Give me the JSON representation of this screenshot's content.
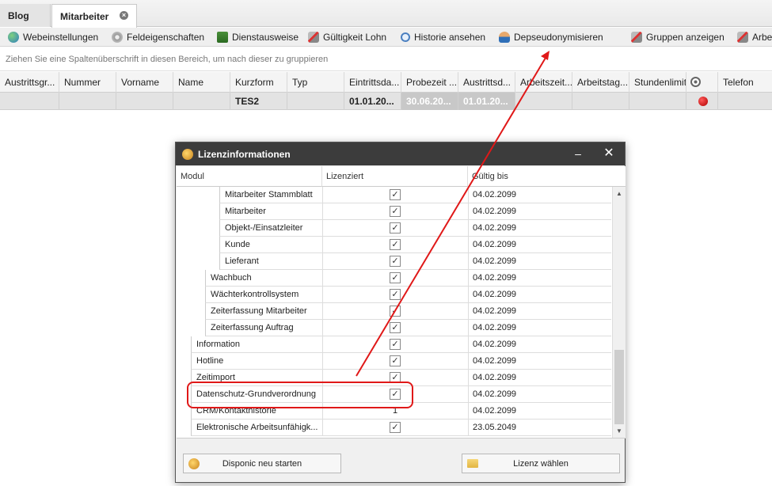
{
  "tabs": [
    {
      "label": "Blog"
    },
    {
      "label": "Mitarbeiter",
      "active": true
    }
  ],
  "toolbar": {
    "items": [
      {
        "label": "Webeinstellungen",
        "icon": "globe-icon"
      },
      {
        "label": "Feldeigenschaften",
        "icon": "gear-icon"
      },
      {
        "label": "Dienstausweise",
        "icon": "id-card-icon"
      },
      {
        "label": "Gültigkeit Lohn",
        "icon": "tools-icon"
      },
      {
        "label": "Historie ansehen",
        "icon": "magnifier-icon"
      },
      {
        "label": "Depseudonymisieren",
        "icon": "user-icon"
      },
      {
        "label": "Gruppen anzeigen",
        "icon": "tools-icon"
      },
      {
        "label": "Arbe",
        "icon": "tools-icon"
      }
    ]
  },
  "group_panel_text": "Ziehen Sie eine Spaltenüberschrift in diesen Bereich, um nach dieser zu gruppieren",
  "grid": {
    "columns": [
      "Austrittsgr...",
      "Nummer",
      "Vorname",
      "Name",
      "Kurzform",
      "Typ",
      "Eintrittsda...",
      "Probezeit ...",
      "Austrittsd...",
      "Arbeitszeit...",
      "Arbeitstag...",
      "Stundenlimit",
      "",
      "Telefon"
    ],
    "row": {
      "kurzform": "TES2",
      "eintritt": "01.01.20...",
      "probezeit": "30.06.20...",
      "austritt": "01.01.20..."
    }
  },
  "dialog": {
    "title": "Lizenzinformationen",
    "columns": {
      "modul": "Modul",
      "lizenziert": "Lizenziert",
      "gueltig": "Gültig bis"
    },
    "rows": [
      {
        "name": "Mitarbeiter Stammblatt",
        "level": 3,
        "licensed": "check",
        "date": "04.02.2099"
      },
      {
        "name": "Mitarbeiter",
        "level": 3,
        "licensed": "check",
        "date": "04.02.2099"
      },
      {
        "name": "Objekt-/Einsatzleiter",
        "level": 3,
        "licensed": "check",
        "date": "04.02.2099"
      },
      {
        "name": "Kunde",
        "level": 3,
        "licensed": "check",
        "date": "04.02.2099"
      },
      {
        "name": "Lieferant",
        "level": 3,
        "licensed": "check",
        "date": "04.02.2099"
      },
      {
        "name": "Wachbuch",
        "level": 2,
        "licensed": "check",
        "date": "04.02.2099"
      },
      {
        "name": "Wächterkontrollsystem",
        "level": 2,
        "licensed": "check",
        "date": "04.02.2099"
      },
      {
        "name": "Zeiterfassung Mitarbeiter",
        "level": 2,
        "licensed": "check",
        "date": "04.02.2099"
      },
      {
        "name": "Zeiterfassung Auftrag",
        "level": 2,
        "licensed": "check",
        "date": "04.02.2099"
      },
      {
        "name": "Information",
        "level": 1,
        "licensed": "check",
        "date": "04.02.2099"
      },
      {
        "name": "Hotline",
        "level": 1,
        "licensed": "check",
        "date": "04.02.2099"
      },
      {
        "name": "Zeitimport",
        "level": 1,
        "licensed": "check",
        "date": "04.02.2099"
      },
      {
        "name": "Datenschutz-Grundverordnung",
        "level": 1,
        "licensed": "check",
        "date": "04.02.2099",
        "highlighted": true
      },
      {
        "name": "CRM/Kontakthistorie",
        "level": 1,
        "licensed": "1",
        "date": "04.02.2099"
      },
      {
        "name": "Elektronische Arbeitsunfähigk...",
        "level": 1,
        "licensed": "check",
        "date": "23.05.2049"
      }
    ],
    "buttons": {
      "restart": "Disponic neu starten",
      "license": "Lizenz wählen"
    },
    "min_symbol": "–",
    "close_symbol": "✕"
  },
  "annotation": {
    "color": "#e01818"
  }
}
